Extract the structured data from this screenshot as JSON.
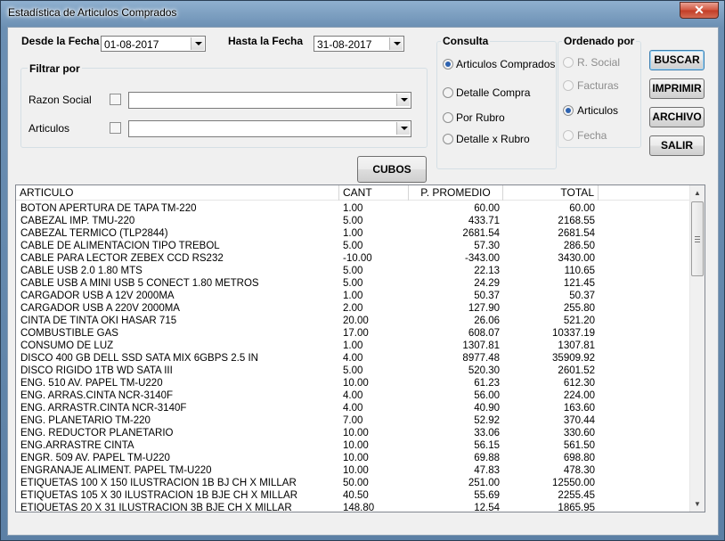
{
  "window": {
    "title": "Estadística de Articulos Comprados",
    "close_glyph": "✕"
  },
  "desde": {
    "label": "Desde la Fecha",
    "value": "01-08-2017"
  },
  "hasta": {
    "label": "Hasta la Fecha",
    "value": "31-08-2017"
  },
  "filtrar": {
    "title": "Filtrar por",
    "razon_social_label": "Razon Social",
    "articulos_label": "Articulos"
  },
  "consulta": {
    "title": "Consulta",
    "options": [
      "Articulos Comprados",
      "Detalle Compra",
      "Por Rubro",
      "Detalle x Rubro"
    ],
    "selected": "Articulos Comprados"
  },
  "ordenado": {
    "title": "Ordenado por",
    "options": [
      "R. Social",
      "Facturas",
      "Articulos",
      "Fecha"
    ],
    "selected": "Articulos"
  },
  "buttons": {
    "buscar": "BUSCAR",
    "imprimir": "IMPRIMIR",
    "archivo": "ARCHIVO",
    "salir": "SALIR",
    "cubos": "CUBOS"
  },
  "table": {
    "columns": [
      "ARTICULO",
      "CANT",
      "P. PROMEDIO",
      "TOTAL"
    ],
    "rows": [
      [
        "BOTON APERTURA DE TAPA TM-220",
        "1.00",
        "60.00",
        "60.00"
      ],
      [
        "CABEZAL IMP. TMU-220",
        "5.00",
        "433.71",
        "2168.55"
      ],
      [
        "CABEZAL TERMICO (TLP2844)",
        "1.00",
        "2681.54",
        "2681.54"
      ],
      [
        "CABLE DE ALIMENTACION TIPO TREBOL",
        "5.00",
        "57.30",
        "286.50"
      ],
      [
        "CABLE PARA LECTOR ZEBEX CCD RS232",
        "-10.00",
        "-343.00",
        "3430.00"
      ],
      [
        "CABLE USB 2.0 1.80 MTS",
        "5.00",
        "22.13",
        "110.65"
      ],
      [
        "CABLE USB A MINI USB 5 CONECT 1.80 METROS",
        "5.00",
        "24.29",
        "121.45"
      ],
      [
        "CARGADOR USB A 12V 2000MA",
        "1.00",
        "50.37",
        "50.37"
      ],
      [
        "CARGADOR USB A 220V 2000MA",
        "2.00",
        "127.90",
        "255.80"
      ],
      [
        "CINTA DE TINTA OKI HASAR 715",
        "20.00",
        "26.06",
        "521.20"
      ],
      [
        "COMBUSTIBLE GAS",
        "17.00",
        "608.07",
        "10337.19"
      ],
      [
        "CONSUMO DE LUZ",
        "1.00",
        "1307.81",
        "1307.81"
      ],
      [
        "DISCO 400 GB DELL SSD SATA MIX 6GBPS 2.5 IN",
        "4.00",
        "8977.48",
        "35909.92"
      ],
      [
        "DISCO RIGIDO 1TB WD SATA III",
        "5.00",
        "520.30",
        "2601.52"
      ],
      [
        "ENG. 510 AV. PAPEL TM-U220",
        "10.00",
        "61.23",
        "612.30"
      ],
      [
        "ENG. ARRAS.CINTA NCR-3140F",
        "4.00",
        "56.00",
        "224.00"
      ],
      [
        "ENG. ARRASTR.CINTA NCR-3140F",
        "4.00",
        "40.90",
        "163.60"
      ],
      [
        "ENG. PLANETARIO TM-220",
        "7.00",
        "52.92",
        "370.44"
      ],
      [
        "ENG. REDUCTOR PLANETARIO",
        "10.00",
        "33.06",
        "330.60"
      ],
      [
        "ENG.ARRASTRE CINTA",
        "10.00",
        "56.15",
        "561.50"
      ],
      [
        "ENGR. 509 AV. PAPEL TM-U220",
        "10.00",
        "69.88",
        "698.80"
      ],
      [
        "ENGRANAJE ALIMENT. PAPEL TM-U220",
        "10.00",
        "47.83",
        "478.30"
      ],
      [
        "ETIQUETAS 100 X 150 ILUSTRACION 1B BJ CH X MILLAR",
        "50.00",
        "251.00",
        "12550.00"
      ],
      [
        "ETIQUETAS 105 X 30 ILUSTRACION 1B BJE CH X MILLAR",
        "40.50",
        "55.69",
        "2255.45"
      ],
      [
        "ETIQUETAS 20 X 31 ILUSTRACION 3B BJE CH X MILLAR",
        "148.80",
        "12.54",
        "1865.95"
      ]
    ]
  }
}
